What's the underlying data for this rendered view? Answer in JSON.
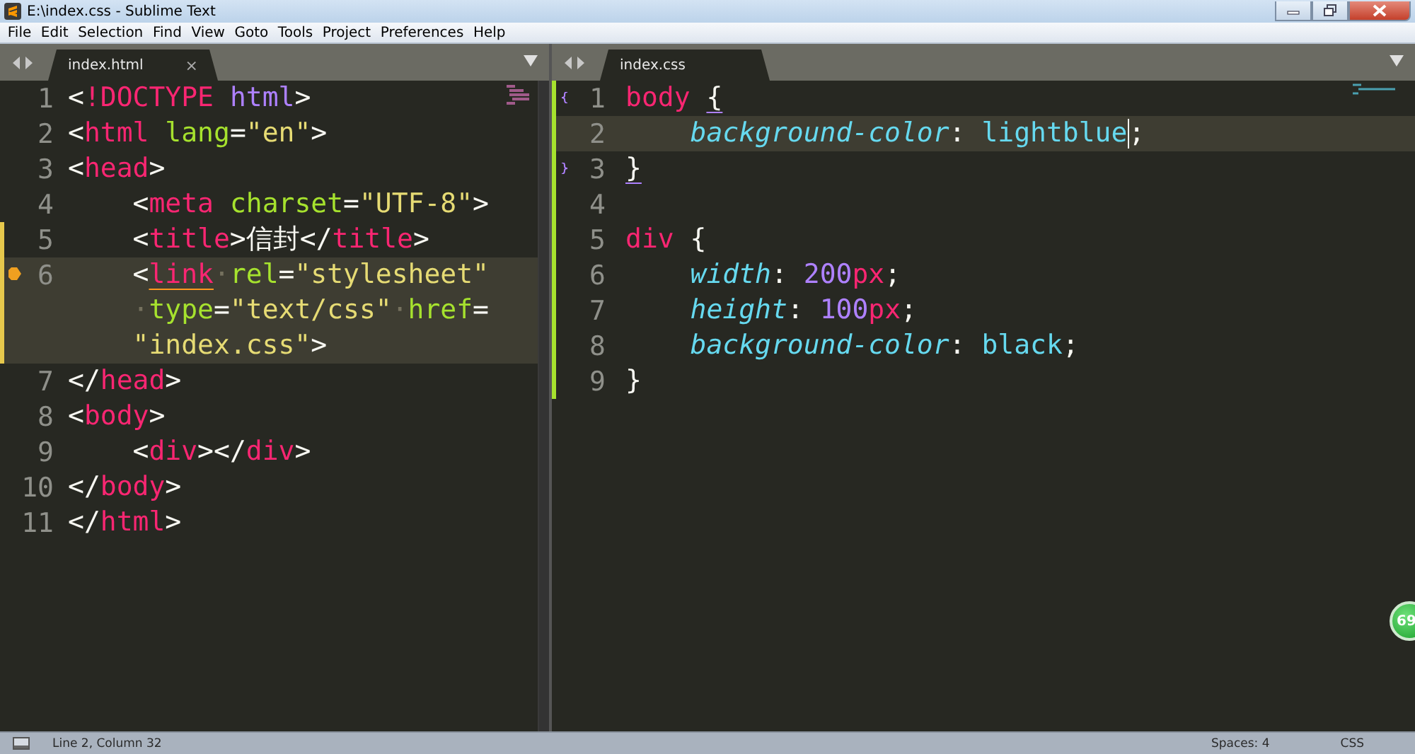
{
  "window": {
    "title": "E:\\index.css - Sublime Text"
  },
  "menu": [
    "File",
    "Edit",
    "Selection",
    "Find",
    "View",
    "Goto",
    "Tools",
    "Project",
    "Preferences",
    "Help"
  ],
  "panes": [
    {
      "tab": {
        "label": "index.html",
        "selected": true,
        "close": "×"
      },
      "kind": "html",
      "lines": [
        {
          "number": "1",
          "rows": [
            "<!DOCTYPE html>"
          ]
        },
        {
          "number": "2",
          "rows": [
            "<html lang=\"en\">"
          ]
        },
        {
          "number": "3",
          "rows": [
            "<head>"
          ]
        },
        {
          "number": "4",
          "rows": [
            "    <meta charset=\"UTF-8\">"
          ]
        },
        {
          "number": "5",
          "modified": true,
          "rows": [
            "    <title>信封</title>"
          ]
        },
        {
          "number": "6",
          "modified": true,
          "current": true,
          "bookmark": true,
          "match_underline": true,
          "rows": [
            "    <link·rel=\"stylesheet\"",
            "    ·type=\"text/css\"·href=",
            "    \"index.css\">"
          ]
        },
        {
          "number": "7",
          "rows": [
            "</head>"
          ]
        },
        {
          "number": "8",
          "rows": [
            "<body>"
          ]
        },
        {
          "number": "9",
          "rows": [
            "    <div></div>"
          ]
        },
        {
          "number": "10",
          "rows": [
            "</body>"
          ]
        },
        {
          "number": "11",
          "rows": [
            "</html>"
          ]
        }
      ]
    },
    {
      "tab": {
        "label": "index.css",
        "selected": true
      },
      "kind": "css",
      "lines": [
        {
          "number": "1",
          "added": true,
          "fold_start": true,
          "match_underline": true,
          "rows": [
            "body {"
          ]
        },
        {
          "number": "2",
          "added": true,
          "current": true,
          "cursor": true,
          "rows": [
            "    background-color: lightblue;"
          ]
        },
        {
          "number": "3",
          "added": true,
          "fold_end": true,
          "match_underline": true,
          "rows": [
            "}"
          ]
        },
        {
          "number": "4",
          "added": true
        },
        {
          "number": "5",
          "added": true,
          "rows": [
            "div {"
          ]
        },
        {
          "number": "6",
          "added": true,
          "rows": [
            "    width: 200px;"
          ]
        },
        {
          "number": "7",
          "added": true,
          "rows": [
            "    height: 100px;"
          ]
        },
        {
          "number": "8",
          "added": true,
          "rows": [
            "    background-color: black;"
          ]
        },
        {
          "number": "9",
          "added": true,
          "rows": [
            "}"
          ]
        }
      ]
    }
  ],
  "floating_badge": {
    "text": "69"
  },
  "status_bar": {
    "position": "Line 2, Column 32",
    "indentation": "Spaces: 4",
    "syntax": "CSS"
  }
}
